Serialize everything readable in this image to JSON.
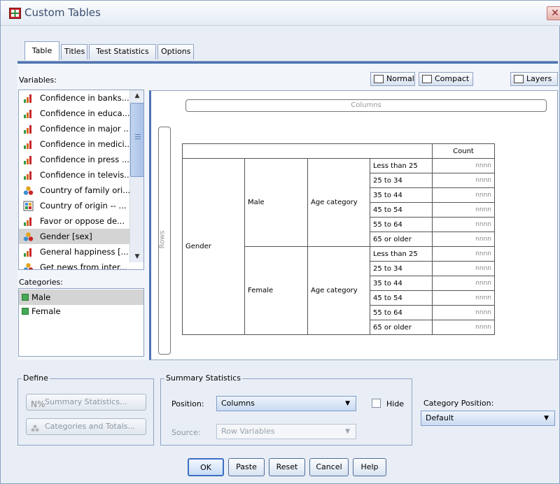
{
  "window": {
    "title": "Custom Tables",
    "close_glyph": "✕"
  },
  "tabs": [
    {
      "label": "Table",
      "active": true
    },
    {
      "label": "Titles"
    },
    {
      "label": "Test Statistics"
    },
    {
      "label": "Options"
    }
  ],
  "variables": {
    "label": "Variables:",
    "items": [
      {
        "label": "Confidence in banks...",
        "icon": "scale-icon"
      },
      {
        "label": "Confidence in educa...",
        "icon": "scale-icon"
      },
      {
        "label": "Confidence in major ...",
        "icon": "scale-icon"
      },
      {
        "label": "Confidence in medici...",
        "icon": "scale-icon"
      },
      {
        "label": "Confidence in press ...",
        "icon": "scale-icon"
      },
      {
        "label": "Confidence in televis...",
        "icon": "scale-icon"
      },
      {
        "label": "Country of family ori...",
        "icon": "nominal-icon"
      },
      {
        "label": "Country of origin -- ...",
        "icon": "multiple-response-icon"
      },
      {
        "label": "Favor or oppose de...",
        "icon": "scale-icon"
      },
      {
        "label": "Gender [sex]",
        "icon": "nominal-icon",
        "selected": true
      },
      {
        "label": "General happiness [...",
        "icon": "scale-icon"
      },
      {
        "label": "Get news from inter...",
        "icon": "nominal-icon"
      }
    ]
  },
  "categories": {
    "label": "Categories:",
    "items": [
      {
        "label": "Male",
        "selected": true
      },
      {
        "label": "Female"
      }
    ]
  },
  "toolbar": {
    "normal": "Normal",
    "compact": "Compact",
    "layers": "Layers"
  },
  "preview": {
    "columns_label": "Columns",
    "rows_label": "Rows",
    "count_header": "Count",
    "row_var": "Gender",
    "groups": [
      {
        "value": "Male",
        "nested_var": "Age category",
        "cats": [
          "Less than 25",
          "25 to 34",
          "35 to 44",
          "45 to 54",
          "55 to 64",
          "65 or older"
        ]
      },
      {
        "value": "Female",
        "nested_var": "Age category",
        "cats": [
          "Less than 25",
          "25 to 34",
          "35 to 44",
          "45 to 54",
          "55 to 64",
          "65 or older"
        ]
      }
    ],
    "cell_placeholder": "nnnn"
  },
  "define": {
    "legend": "Define",
    "summary_button": "Summary Statistics...",
    "categories_button": "Categories and Totals..."
  },
  "summary": {
    "legend": "Summary Statistics",
    "position_label": "Position:",
    "position_value": "Columns",
    "hide_label": "Hide",
    "source_label": "Source:",
    "source_value": "Row Variables"
  },
  "category_position": {
    "label": "Category Position:",
    "value": "Default"
  },
  "buttons": {
    "ok": "OK",
    "paste": "Paste",
    "reset": "Reset",
    "cancel": "Cancel",
    "help": "Help"
  }
}
